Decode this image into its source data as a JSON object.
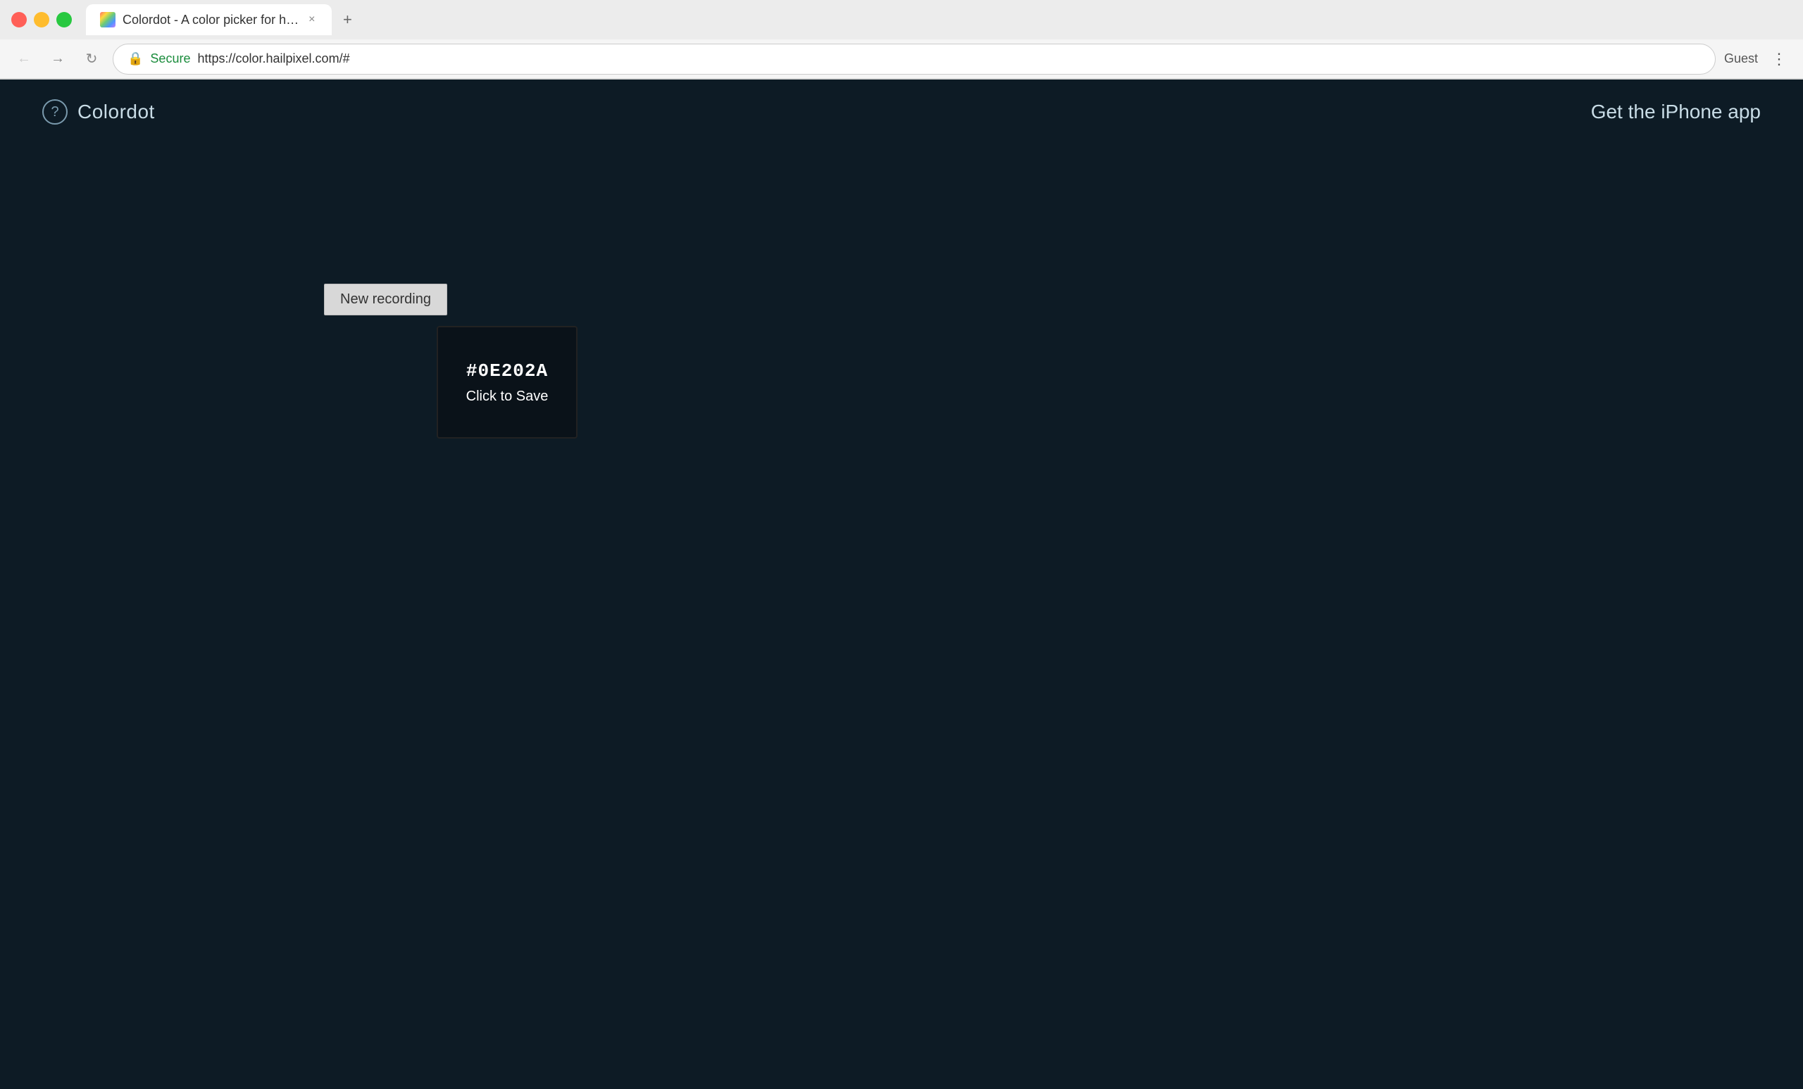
{
  "browser": {
    "window_controls": {
      "close_label": "×",
      "minimize_label": "–",
      "maximize_label": "+"
    },
    "tab": {
      "title": "Colordot - A color picker for h…",
      "favicon_alt": "colordot-favicon"
    },
    "address_bar": {
      "secure_label": "Secure",
      "url": "https://color.hailpixel.com/#"
    },
    "user_label": "Guest"
  },
  "header": {
    "logo_text": "Colordot",
    "logo_icon": "?",
    "iphone_app_link": "Get the iPhone app"
  },
  "main": {
    "new_recording_btn": "New recording",
    "color_card": {
      "hex_value": "#0E202A",
      "save_label": "Click to Save"
    }
  }
}
